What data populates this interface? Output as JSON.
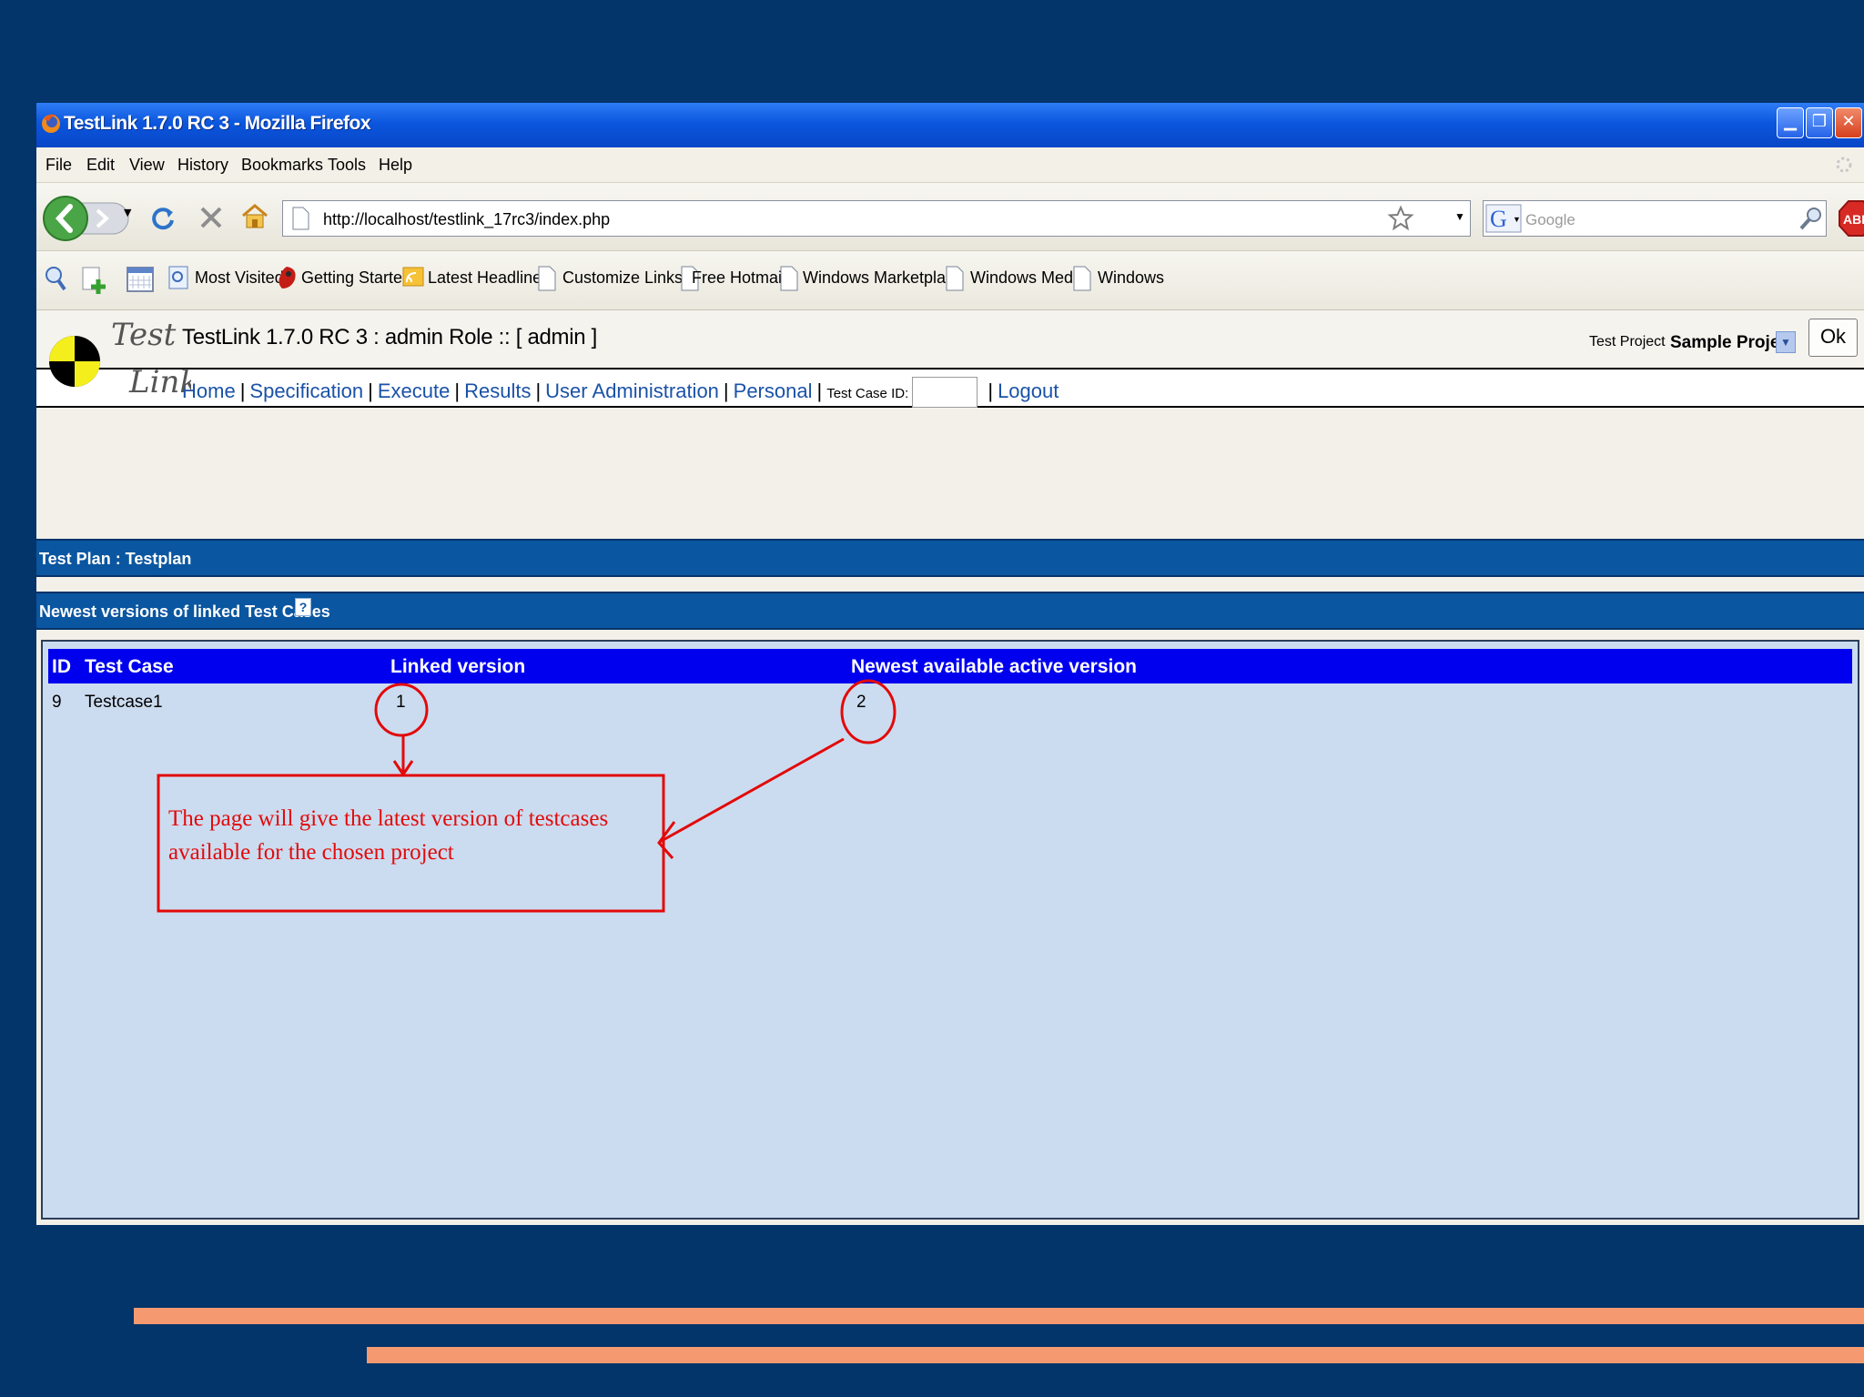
{
  "window": {
    "title": "TestLink 1.7.0 RC 3 - Mozilla Firefox"
  },
  "menu": [
    "File",
    "Edit",
    "View",
    "History",
    "Bookmarks",
    "Tools",
    "Help"
  ],
  "navigation": {
    "url": "http://localhost/testlink_17rc3/index.php",
    "search_placeholder": "Google"
  },
  "bookmarks": [
    "Most Visited",
    "Getting Started",
    "Latest Headlines",
    "Customize Links",
    "Free Hotmail",
    "Windows Marketplace",
    "Windows Media",
    "Windows"
  ],
  "testlink": {
    "logo_text_top": "Test",
    "logo_text_bottom": "Link",
    "header_title": "TestLink 1.7.0 RC 3 : admin Role :: [ admin ]",
    "project_label": "Test Project",
    "project_value": "Sample Project",
    "ok_label": "Ok",
    "nav_links": [
      "Home",
      "Specification",
      "Execute",
      "Results",
      "User Administration",
      "Personal"
    ],
    "test_case_id_label": "Test Case ID:",
    "logout_label": "Logout"
  },
  "page": {
    "test_plan_label": "Test Plan : Testplan",
    "section_title": "Newest versions of linked Test Cases",
    "help_icon": "?",
    "table": {
      "headers": [
        "ID",
        "Test Case",
        "Linked version",
        "Newest available active version"
      ],
      "rows": [
        [
          "9",
          "Testcase1",
          "1",
          "2"
        ]
      ]
    }
  },
  "annotation": {
    "callout_line1": "The page will give the latest version of testcases",
    "callout_line2": "available  for the chosen project",
    "color": "#e20a0a"
  },
  "colors": {
    "slide_background": "#03346a",
    "slide_accent": "#f59a70",
    "title_bar": "#0b56dd",
    "section_band": "#0a56a0",
    "table_header": "#0000ee",
    "panel": "#ccdcf0"
  }
}
